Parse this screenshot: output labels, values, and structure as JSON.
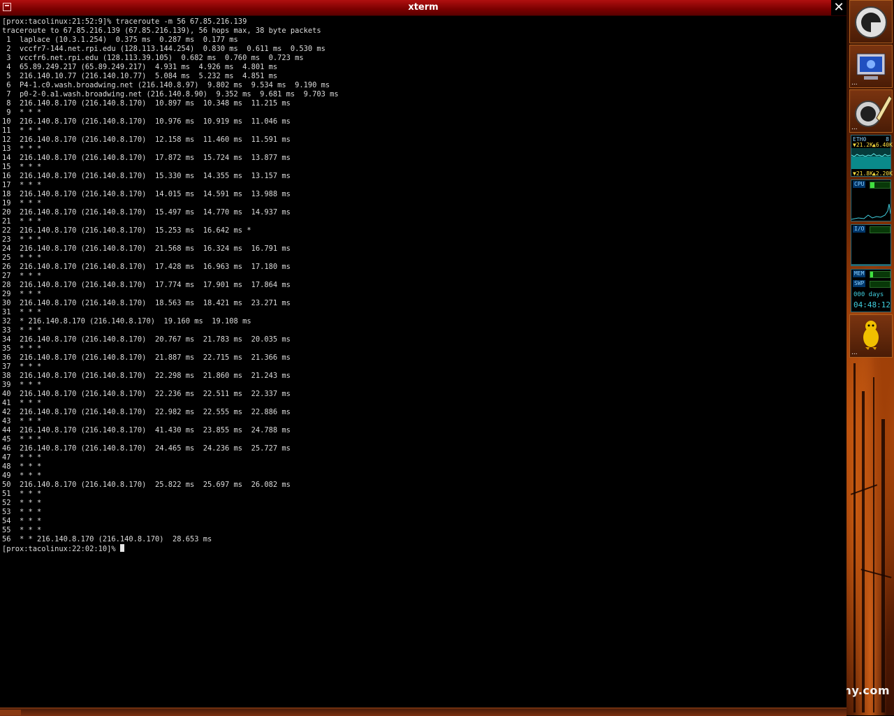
{
  "window": {
    "title": "xterm",
    "close_glyph": "✕"
  },
  "terminal": {
    "lines": [
      "[prox:tacolinux:21:52:9]% traceroute -m 56 67.85.216.139",
      "traceroute to 67.85.216.139 (67.85.216.139), 56 hops max, 38 byte packets",
      " 1  laplace (10.3.1.254)  0.375 ms  0.287 ms  0.177 ms",
      " 2  vccfr7-144.net.rpi.edu (128.113.144.254)  0.830 ms  0.611 ms  0.530 ms",
      " 3  vccfr6.net.rpi.edu (128.113.39.105)  0.682 ms  0.760 ms  0.723 ms",
      " 4  65.89.249.217 (65.89.249.217)  4.931 ms  4.926 ms  4.801 ms",
      " 5  216.140.10.77 (216.140.10.77)  5.084 ms  5.232 ms  4.851 ms",
      " 6  P4-1.c0.wash.broadwing.net (216.140.8.97)  9.802 ms  9.534 ms  9.190 ms",
      " 7  p0-2-0.a1.wash.broadwing.net (216.140.8.90)  9.352 ms  9.681 ms  9.703 ms",
      " 8  216.140.8.170 (216.140.8.170)  10.897 ms  10.348 ms  11.215 ms",
      " 9  * * *",
      "10  216.140.8.170 (216.140.8.170)  10.976 ms  10.919 ms  11.046 ms",
      "11  * * *",
      "12  216.140.8.170 (216.140.8.170)  12.158 ms  11.460 ms  11.591 ms",
      "13  * * *",
      "14  216.140.8.170 (216.140.8.170)  17.872 ms  15.724 ms  13.877 ms",
      "15  * * *",
      "16  216.140.8.170 (216.140.8.170)  15.330 ms  14.355 ms  13.157 ms",
      "17  * * *",
      "18  216.140.8.170 (216.140.8.170)  14.015 ms  14.591 ms  13.988 ms",
      "19  * * *",
      "20  216.140.8.170 (216.140.8.170)  15.497 ms  14.770 ms  14.937 ms",
      "21  * * *",
      "22  216.140.8.170 (216.140.8.170)  15.253 ms  16.642 ms *",
      "23  * * *",
      "24  216.140.8.170 (216.140.8.170)  21.568 ms  16.324 ms  16.791 ms",
      "25  * * *",
      "26  216.140.8.170 (216.140.8.170)  17.428 ms  16.963 ms  17.180 ms",
      "27  * * *",
      "28  216.140.8.170 (216.140.8.170)  17.774 ms  17.901 ms  17.864 ms",
      "29  * * *",
      "30  216.140.8.170 (216.140.8.170)  18.563 ms  18.421 ms  23.271 ms",
      "31  * * *",
      "32  * 216.140.8.170 (216.140.8.170)  19.160 ms  19.108 ms",
      "33  * * *",
      "34  216.140.8.170 (216.140.8.170)  20.767 ms  21.783 ms  20.035 ms",
      "35  * * *",
      "36  216.140.8.170 (216.140.8.170)  21.887 ms  22.715 ms  21.366 ms",
      "37  * * *",
      "38  216.140.8.170 (216.140.8.170)  22.298 ms  21.860 ms  21.243 ms",
      "39  * * *",
      "40  216.140.8.170 (216.140.8.170)  22.236 ms  22.511 ms  22.337 ms",
      "41  * * *",
      "42  216.140.8.170 (216.140.8.170)  22.982 ms  22.555 ms  22.886 ms",
      "43  * * *",
      "44  216.140.8.170 (216.140.8.170)  41.430 ms  23.855 ms  24.788 ms",
      "45  * * *",
      "46  216.140.8.170 (216.140.8.170)  24.465 ms  24.236 ms  25.727 ms",
      "47  * * *",
      "48  * * *",
      "49  * * *",
      "50  216.140.8.170 (216.140.8.170)  25.822 ms  25.697 ms  26.082 ms",
      "51  * * *",
      "52  * * *",
      "53  * * *",
      "54  * * *",
      "55  * * *",
      "56  * * 216.140.8.170 (216.140.8.170)  28.653 ms"
    ],
    "prompt": "[prox:tacolinux:22:02:10]% "
  },
  "dock": {
    "tile_dots": "...",
    "net_monitor": {
      "label": "ETH0",
      "count": "8",
      "rx": "▼21.2K",
      "tx": "▲6.40K",
      "rx2": "▼21.8K",
      "tx2": "▲2.20K"
    },
    "cpu_monitor": {
      "label": "CPU"
    },
    "io_monitor": {
      "label": "I/O"
    },
    "mem_monitor": {
      "mem_label": "MEM",
      "swp_label": "SWP",
      "uptime_days": "000 days",
      "uptime_clock": "04:48:12"
    },
    "icons": [
      "gimp-like-icon",
      "monitor-icon",
      "gimp-pencil-icon",
      "penguin-icon"
    ]
  },
  "desktop": {
    "text": "my.com"
  },
  "colors": {
    "titlebar": "#8a0000",
    "terminal_bg": "#000000",
    "terminal_fg": "#dcdcdc",
    "monitor_green": "#40e040",
    "monitor_cyan": "#4ad0e0"
  }
}
